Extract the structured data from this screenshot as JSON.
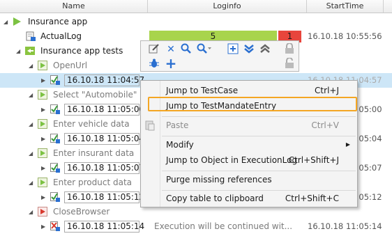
{
  "columns": {
    "name": "Name",
    "loginfo": "Loginfo",
    "starttime": "StartTime"
  },
  "tree": {
    "root_label": "Insurance app",
    "actuallog": {
      "label": "ActualLog",
      "pass_count": "5",
      "fail_count": "1",
      "time": "16.10.18 10:55:56"
    },
    "tests_label": "Insurance app tests",
    "nodes": [
      {
        "label": "OpenUrl",
        "entry_time": "16.10.18 11:04:57",
        "start": "16.10.18 11:04:57"
      },
      {
        "label": "Select \"Automobile\"",
        "entry_time": "16.10.18 11:05:00",
        "start": "16.10.18 11:05:00"
      },
      {
        "label": "Enter vehicle data",
        "entry_time": "16.10.18 11:05:04",
        "start": "16.10.18 11:05:04"
      },
      {
        "label": "Enter insurant data",
        "entry_time": "16.10.18 11:05:07",
        "start": "16.10.18 11:05:07"
      },
      {
        "label": "Enter product data",
        "entry_time": "16.10.18 11:05:12",
        "start": "16.10.18 11:05:12"
      },
      {
        "label": "CloseBrowser",
        "entry_time": "16.10.18 11:05:14",
        "loginfo": "Execution will be continued wit...",
        "start": "16.10.18 11:05:14"
      }
    ]
  },
  "menu": {
    "jump_testcase": {
      "label": "Jump to TestCase",
      "shortcut": "Ctrl+J"
    },
    "jump_mandate": {
      "label": "Jump to TestMandateEntry"
    },
    "paste": {
      "label": "Paste",
      "shortcut": "Ctrl+V"
    },
    "modify": {
      "label": "Modify"
    },
    "jump_object": {
      "label": "Jump to Object in ExecutionLog",
      "shortcut": "Ctrl+Shift+J"
    },
    "purge": {
      "label": "Purge missing references"
    },
    "copy_table": {
      "label": "Copy table to clipboard",
      "shortcut": "Ctrl+Shift+C"
    }
  },
  "colors": {
    "pass": "#a8d44c",
    "fail": "#e8453c",
    "highlight": "#f4a623",
    "selection": "#cde6f7"
  }
}
